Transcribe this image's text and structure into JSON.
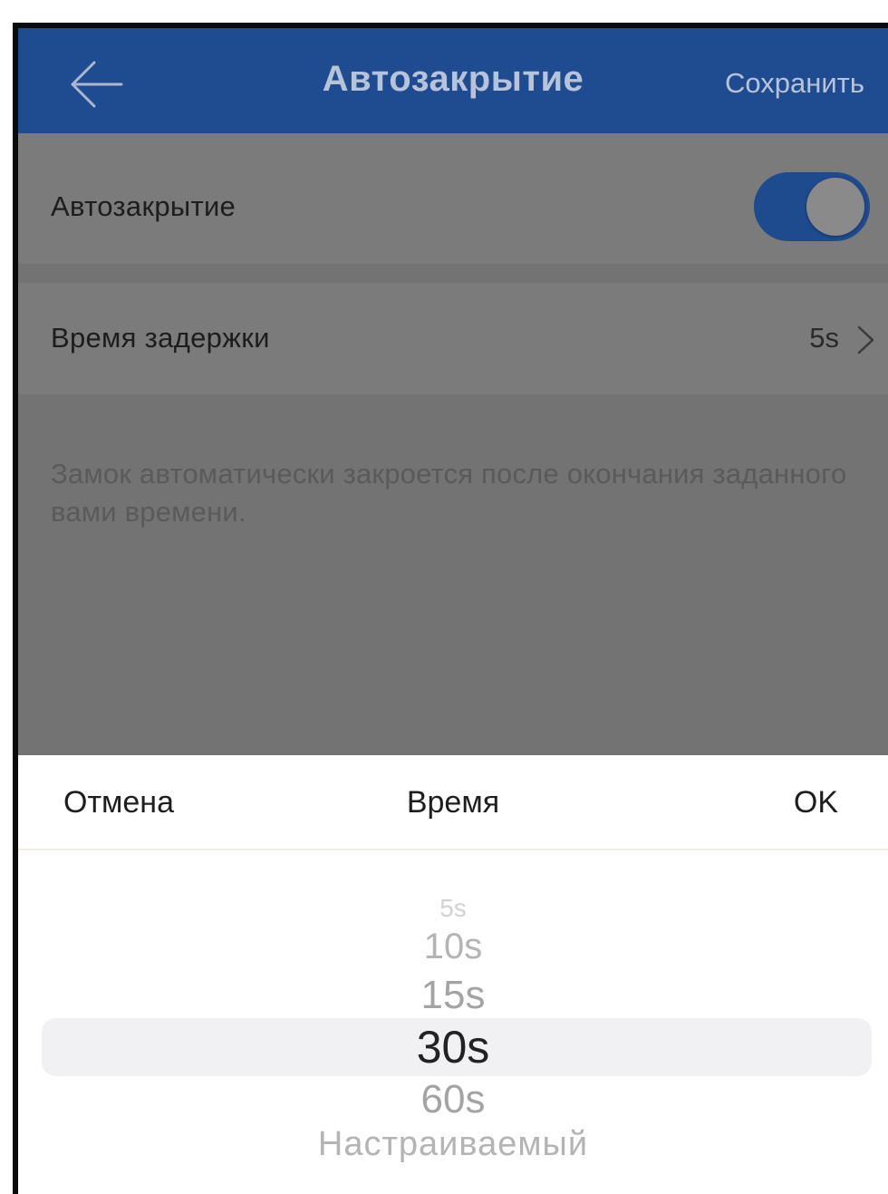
{
  "header": {
    "back_icon": "arrow-left-icon",
    "title": "Автозакрытие",
    "save_label": "Сохранить"
  },
  "settings": {
    "auto_close_label": "Автозакрытие",
    "auto_close_on": true,
    "delay_label": "Время задержки",
    "delay_value": "5s",
    "description": "Замок автоматически закроется после окончания заданного вами времени."
  },
  "picker": {
    "cancel_label": "Отмена",
    "title": "Время",
    "ok_label": "OK",
    "options": [
      "5s",
      "10s",
      "15s",
      "30s",
      "60s",
      "Настраиваемый"
    ],
    "selected": "30s"
  },
  "colors": {
    "brand": "#1f4b91",
    "toggle_on": "#1e4a8e"
  }
}
